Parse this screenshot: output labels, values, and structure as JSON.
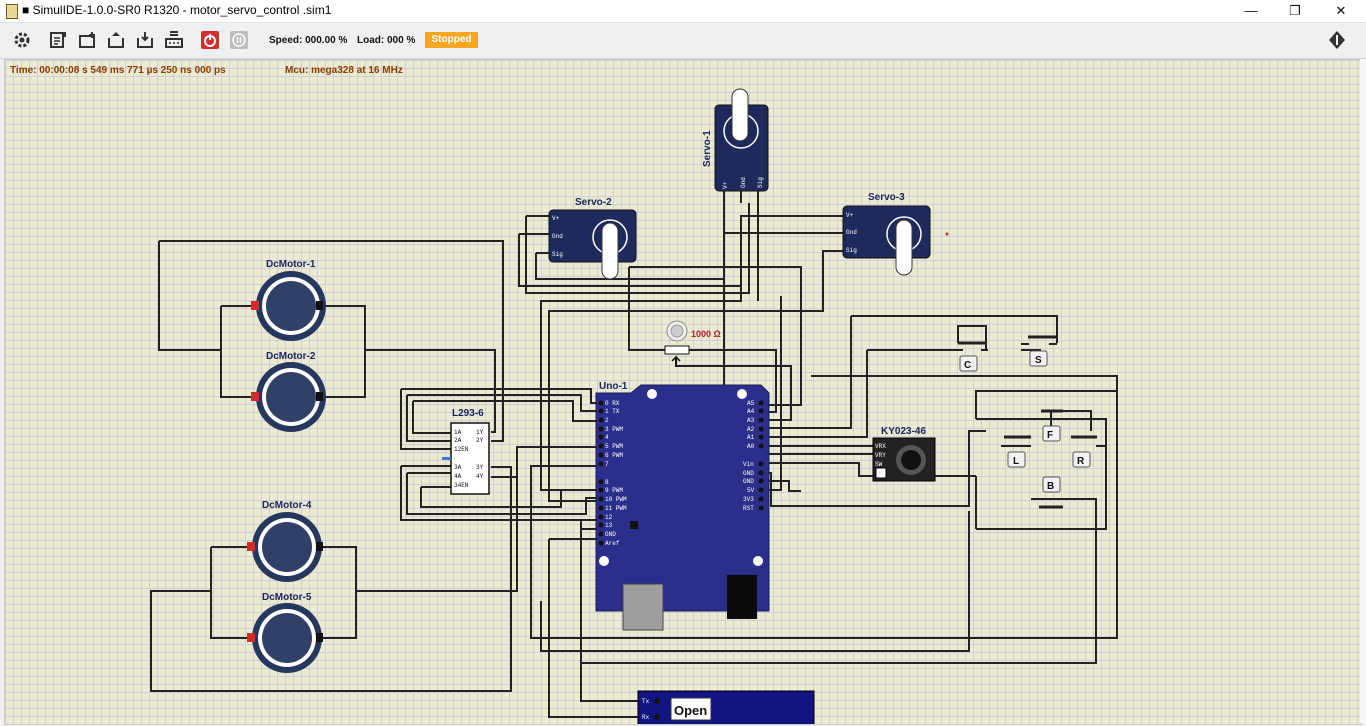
{
  "window": {
    "title": "■ SimulIDE-1.0.0-SR0 R1320 - motor_servo_control .sim1",
    "minimize": "—",
    "maximize": "❐",
    "close": "✕"
  },
  "toolbar": {
    "buttons": [
      {
        "name": "settings-icon"
      },
      {
        "name": "new-circuit-icon"
      },
      {
        "name": "open-circuit-icon"
      },
      {
        "name": "save-circuit-icon"
      },
      {
        "name": "save-as-icon"
      },
      {
        "name": "export-icon"
      },
      {
        "name": "power-icon"
      },
      {
        "name": "pause-icon"
      }
    ],
    "speed": "Speed: 000.00 %",
    "load": "Load: 000 %",
    "status": "Stopped",
    "status_color": "#f6a623"
  },
  "status": {
    "time": "Time: 00:00:08 s  549 ms  771 µs  250 ns  000 ps",
    "mcu": "Mcu: mega328 at 16 MHz"
  },
  "components": {
    "servo1": "Servo-1",
    "servo2": "Servo-2",
    "servo3": "Servo-3",
    "motor1": "DcMotor-1",
    "motor2": "DcMotor-2",
    "motor4": "DcMotor-4",
    "motor5": "DcMotor-5",
    "driver": "L293-6",
    "board": "Uno-1",
    "joystick": "KY023-46",
    "resistor_value": "1000 Ω",
    "serial_open": "Open"
  },
  "servo_pins": [
    "V+",
    "Gnd",
    "Sig"
  ],
  "driver_pins_left": [
    "1A",
    "2A",
    "12EN",
    "",
    "3A",
    "4A",
    "34EN"
  ],
  "driver_pins_right": [
    "1Y",
    "2Y",
    "3Y",
    "4Y"
  ],
  "uno_pins_left": [
    "0 RX",
    "1 TX",
    "2",
    "3 PWM",
    "4",
    "5 PWM",
    "6 PWM",
    "7",
    "8",
    "9 PWM",
    "10 PWM",
    "11 PWM",
    "12",
    "13",
    "GND",
    "Aref"
  ],
  "uno_pins_right": [
    "A5",
    "A4",
    "A3",
    "A2",
    "A1",
    "A0",
    "Vin",
    "GND",
    "GND",
    "5V",
    "3V3",
    "RST"
  ],
  "joystick_pins": [
    "VRX",
    "VRY",
    "SW"
  ],
  "serial_pins": [
    "Tx",
    "Rx"
  ],
  "buttons": [
    "C",
    "S",
    "F",
    "L",
    "R",
    "B"
  ]
}
